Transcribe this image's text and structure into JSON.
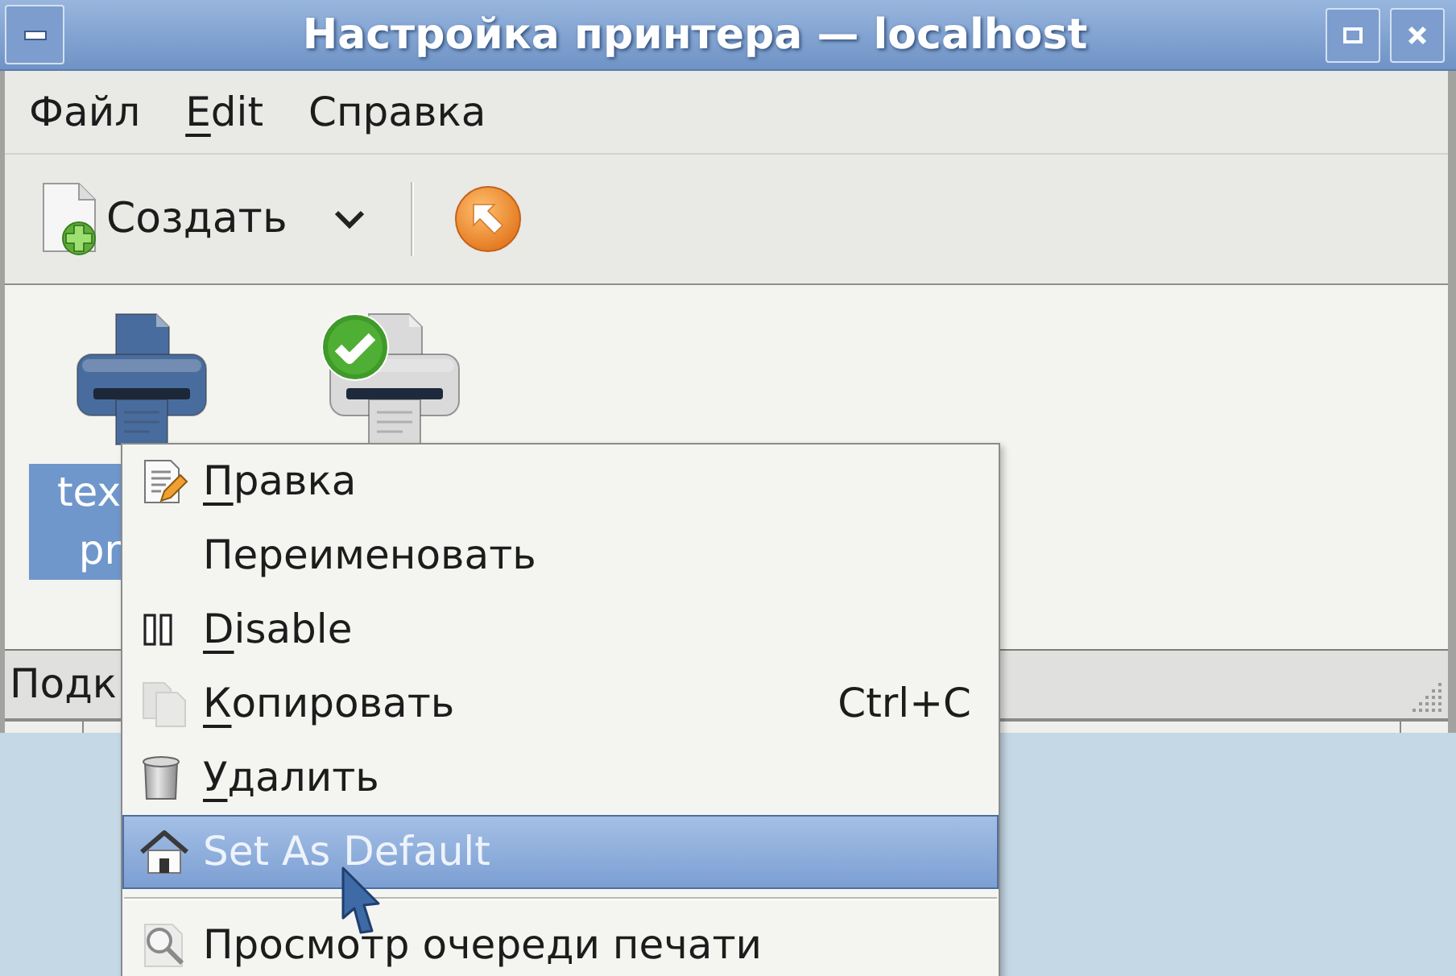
{
  "window": {
    "title": "Настройка принтера — localhost"
  },
  "menubar": [
    {
      "label": "Файл",
      "mnemonic": false
    },
    {
      "label": "Edit",
      "mnemonic": true
    },
    {
      "label": "Справка",
      "mnemonic": false
    }
  ],
  "toolbar": {
    "new_button": {
      "label": "Создать"
    }
  },
  "printers": [
    {
      "label_lines": [
        "tex",
        "pr"
      ],
      "selected": true,
      "default": false,
      "color": "#4f74aa"
    },
    {
      "selected": false,
      "default": true,
      "color": "#dadada"
    }
  ],
  "status_bar": {
    "text": "Подк"
  },
  "context_menu": {
    "items": [
      {
        "kind": "item",
        "label": "Правка",
        "mnemonic": true,
        "selected": false
      },
      {
        "kind": "item",
        "label": "Переименовать",
        "mnemonic": false,
        "selected": false
      },
      {
        "kind": "item",
        "label": "Disable",
        "mnemonic": true,
        "selected": false
      },
      {
        "kind": "item",
        "label": "Копировать",
        "mnemonic": true,
        "selected": false,
        "shortcut": "Ctrl+C"
      },
      {
        "kind": "item",
        "label": "Удалить",
        "mnemonic": true,
        "selected": false
      },
      {
        "kind": "item",
        "label": "Set As Default",
        "mnemonic": false,
        "selected": true
      },
      {
        "kind": "separator"
      },
      {
        "kind": "item",
        "label": "Просмотр очереди печати",
        "mnemonic": false,
        "selected": false
      }
    ]
  }
}
